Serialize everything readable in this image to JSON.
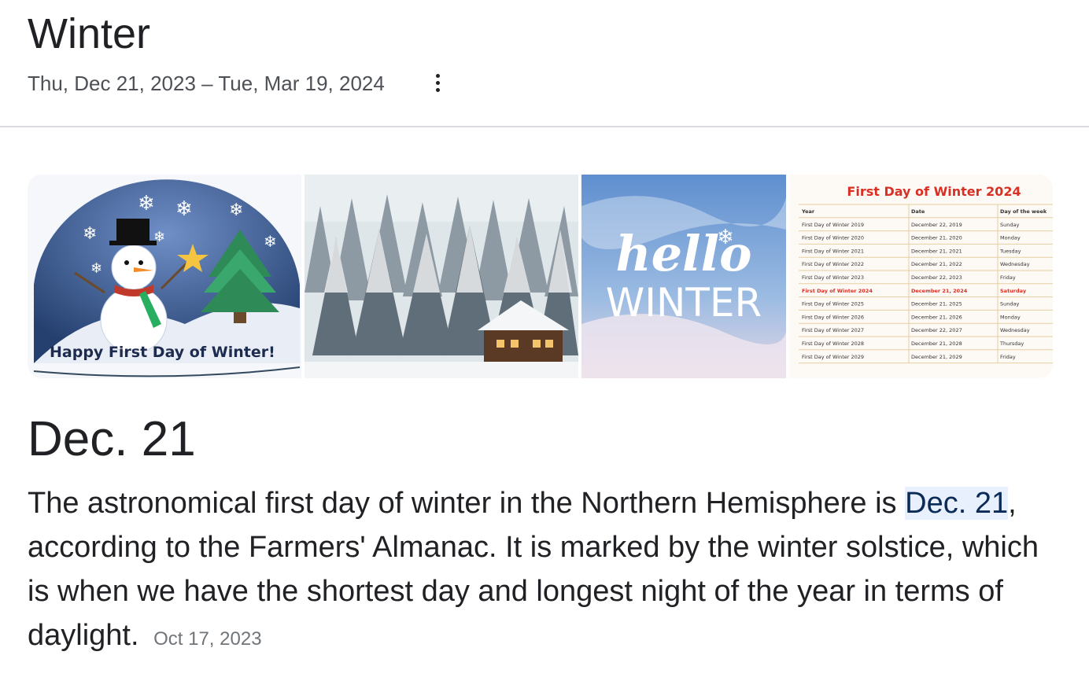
{
  "header": {
    "title": "Winter",
    "date_range": "Thu, Dec 21, 2023 – Tue, Mar 19, 2024",
    "more_icon": "more-vert-icon"
  },
  "images": [
    {
      "name": "snowman-image",
      "caption": "Happy First Day of Winter!"
    },
    {
      "name": "snowy-forest-cabin-image"
    },
    {
      "name": "hello-winter-image",
      "line1": "hello",
      "line2": "WINTER"
    },
    {
      "name": "first-day-of-winter-table-image",
      "title": "First Day of Winter 2024",
      "columns": [
        "Year",
        "Date",
        "Day of the week"
      ],
      "rows": [
        [
          "First Day of Winter 2019",
          "December 22, 2019",
          "Sunday"
        ],
        [
          "First Day of Winter 2020",
          "December 21, 2020",
          "Monday"
        ],
        [
          "First Day of Winter 2021",
          "December 21, 2021",
          "Tuesday"
        ],
        [
          "First Day of Winter 2022",
          "December 21, 2022",
          "Wednesday"
        ],
        [
          "First Day of Winter 2023",
          "December 22, 2023",
          "Friday"
        ],
        [
          "First Day of Winter 2024",
          "December 21, 2024",
          "Saturday"
        ],
        [
          "First Day of Winter 2025",
          "December 21, 2025",
          "Sunday"
        ],
        [
          "First Day of Winter 2026",
          "December 21, 2026",
          "Monday"
        ],
        [
          "First Day of Winter 2027",
          "December 22, 2027",
          "Wednesday"
        ],
        [
          "First Day of Winter 2028",
          "December 21, 2028",
          "Thursday"
        ],
        [
          "First Day of Winter 2029",
          "December 21, 2029",
          "Friday"
        ]
      ],
      "highlight_row": 5
    }
  ],
  "answer": {
    "headline": "Dec. 21",
    "text_before": "The astronomical first day of winter in the Northern Hemisphere is ",
    "highlight": "Dec. 21",
    "text_after": ", according to the Farmers' Almanac. It is marked by the winter solstice, which is when we have the shortest day and longest night of the year in terms of daylight.",
    "source_date": "Oct 17, 2023"
  },
  "colors": {
    "highlight_bg": "#e8f0fe",
    "table_title": "#d93025"
  }
}
